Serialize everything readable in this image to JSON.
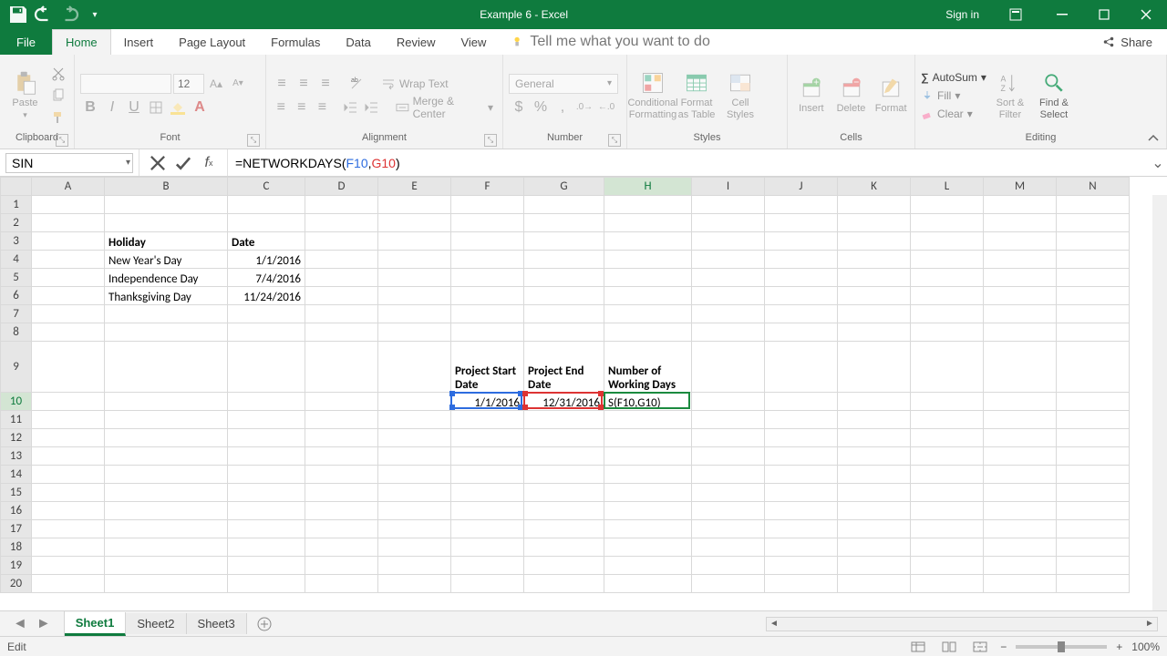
{
  "title": "Example 6  -  Excel",
  "signin": "Sign in",
  "tabs": {
    "file": "File",
    "home": "Home",
    "insert": "Insert",
    "page_layout": "Page Layout",
    "formulas": "Formulas",
    "data": "Data",
    "review": "Review",
    "view": "View",
    "tellme": "Tell me what you want to do",
    "share": "Share"
  },
  "ribbon": {
    "clipboard": {
      "paste": "Paste",
      "label": "Clipboard"
    },
    "font": {
      "size": "12",
      "label": "Font"
    },
    "alignment": {
      "wrap": "Wrap Text",
      "merge": "Merge & Center",
      "label": "Alignment"
    },
    "number": {
      "format": "General",
      "label": "Number"
    },
    "styles": {
      "cond": "Conditional Formatting",
      "fat": "Format as Table",
      "cell": "Cell Styles",
      "label": "Styles"
    },
    "cells": {
      "insert": "Insert",
      "delete": "Delete",
      "format": "Format",
      "label": "Cells"
    },
    "editing": {
      "autosum": "AutoSum",
      "fill": "Fill",
      "clear": "Clear",
      "sort": "Sort & Filter",
      "find": "Find & Select",
      "label": "Editing"
    }
  },
  "formula_bar": {
    "name_box": "SIN",
    "formula_prefix": "=NETWORKDAYS(",
    "arg1": "F10",
    "comma": ",",
    "arg2": "G10",
    "suffix": ")"
  },
  "columns": [
    "A",
    "B",
    "C",
    "D",
    "E",
    "F",
    "G",
    "H",
    "I",
    "J",
    "K",
    "L",
    "M",
    "N"
  ],
  "cells": {
    "B3": "Holiday",
    "C3": "Date",
    "B4": "New Year's Day",
    "C4": "1/1/2016",
    "B5": "Independence Day",
    "C5": "7/4/2016",
    "B6": "Thanksgiving Day",
    "C6": "11/24/2016",
    "F9": "Project Start Date",
    "G9": "Project End Date",
    "H9": "Number of Working Days",
    "F10": "1/1/2016",
    "G10": "12/31/2016",
    "H10": "S(F10,G10)"
  },
  "sheets": {
    "active": "Sheet1",
    "s2": "Sheet2",
    "s3": "Sheet3"
  },
  "status": {
    "mode": "Edit",
    "zoom": "100%"
  }
}
